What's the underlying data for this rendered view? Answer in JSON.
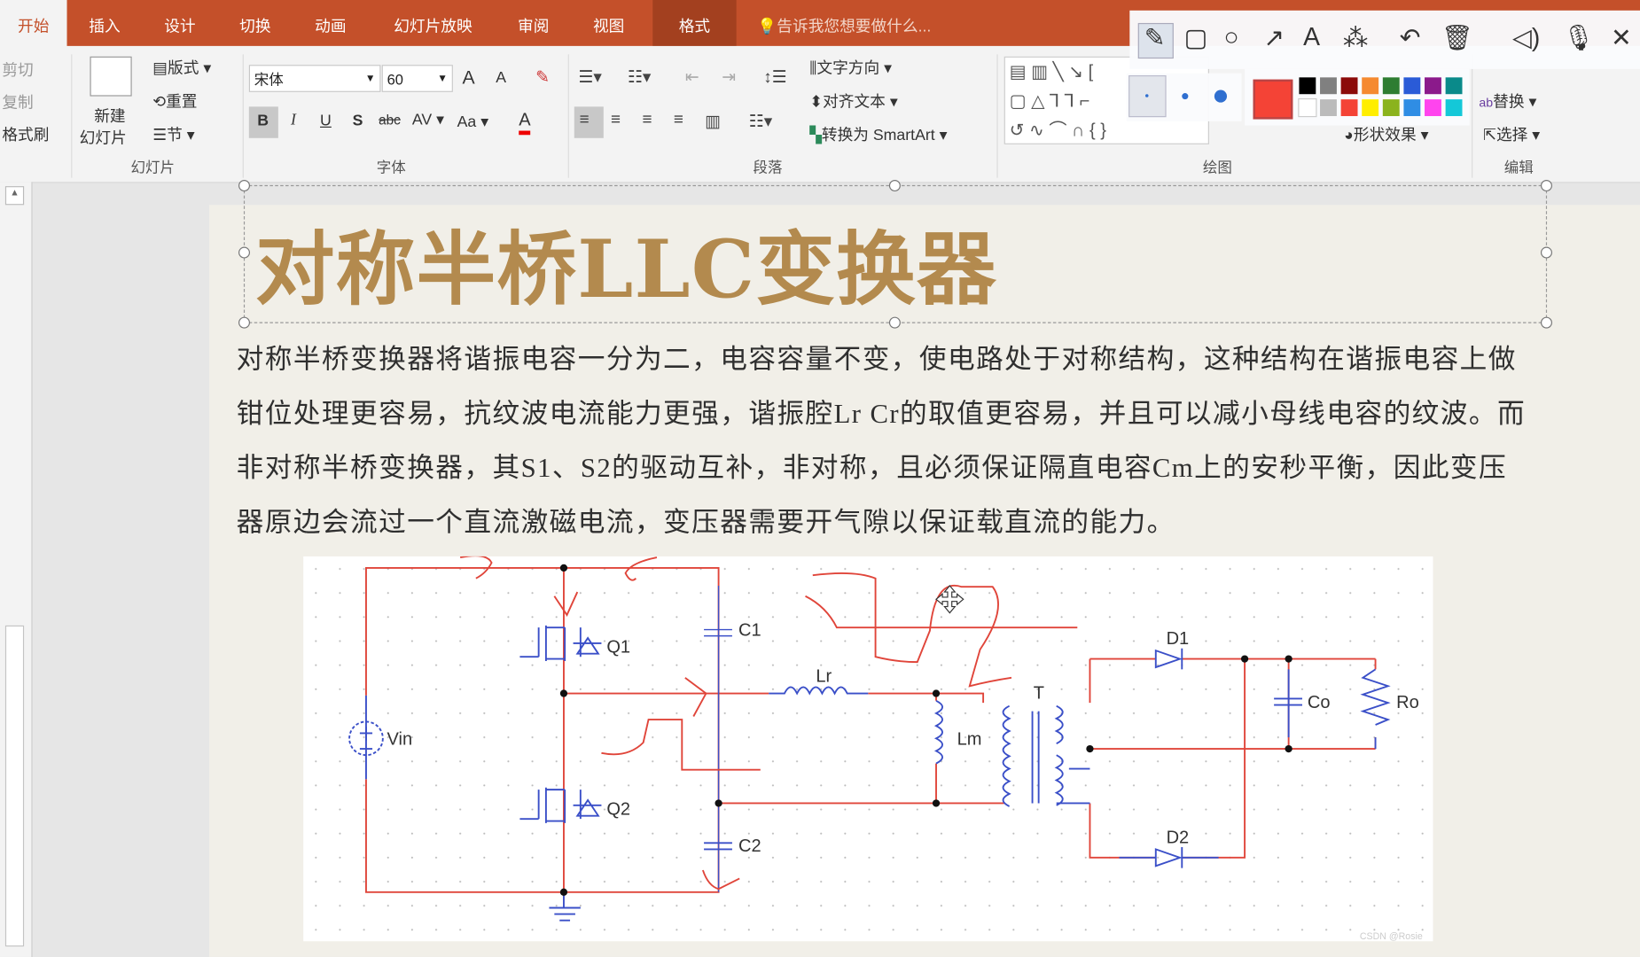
{
  "tabs": [
    "开始",
    "插入",
    "设计",
    "切换",
    "动画",
    "幻灯片放映",
    "审阅",
    "视图",
    "格式"
  ],
  "active_tab": "开始",
  "tell_me": "告诉我您想要做什么...",
  "clipboard": {
    "cut": "剪切",
    "copy": "复制",
    "format_painter": "格式刷"
  },
  "slides": {
    "new_slide_1": "新建",
    "new_slide_2": "幻灯片",
    "layout": "版式",
    "reset": "重置",
    "section": "节",
    "group": "幻灯片"
  },
  "font": {
    "name": "宋体",
    "size": "60",
    "bold": "B",
    "italic": "I",
    "underline": "U",
    "shadow": "S",
    "strike": "abc",
    "spacing": "AV",
    "case": "Aa",
    "color": "A",
    "grow": "A",
    "shrink": "A",
    "group": "字体"
  },
  "paragraph": {
    "text_direction": "文字方向",
    "align_text": "对齐文本",
    "smartart": "转换为 SmartArt",
    "group": "段落"
  },
  "drawing": {
    "shape_effects": "形状效果",
    "group": "绘图"
  },
  "editing": {
    "replace": "替换",
    "select": "选择",
    "group": "编辑"
  },
  "pen_toolbar": {
    "tools": [
      "pencil-icon",
      "rectangle-icon",
      "circle-icon",
      "arrow-icon",
      "text-icon",
      "magic-wand-icon",
      "undo-icon",
      "trash-icon",
      "speaker-icon",
      "microphone-icon",
      "close-icon"
    ],
    "selected_color": "#f44336",
    "colors": [
      "#000000",
      "#808080",
      "#8b0a0a",
      "#f58a30",
      "#2e7d32",
      "#2a5bd7",
      "#8b1a8b",
      "#0a8a8a",
      "#ffffff",
      "#bbbbbb",
      "#f44336",
      "#ffee00",
      "#8bb31d",
      "#2f8de4",
      "#ff44ee",
      "#14c8d8"
    ]
  },
  "slide": {
    "title": "对称半桥LLC变换器",
    "body": "对称半桥变换器将谐振电容一分为二，电容容量不变，使电路处于对称结构，这种结构在谐振电容上做钳位处理更容易，抗纹波电流能力更强，谐振腔Lr Cr的取值更容易，并且可以减小母线电容的纹波。而非对称半桥变换器，其S1、S2的驱动互补，非对称，且必须保证隔直电容Cm上的安秒平衡，因此变压器原边会流过一个直流激磁电流，变压器需要开气隙以保证载直流的能力。",
    "circuit_labels": {
      "vin": "Vin",
      "q1": "Q1",
      "q2": "Q2",
      "c1": "C1",
      "c2": "C2",
      "lr": "Lr",
      "lm": "Lm",
      "t": "T",
      "d1": "D1",
      "d2": "D2",
      "co": "Co",
      "ro": "Ro"
    },
    "watermark": "CSDN @Rosie"
  },
  "colors": {
    "accent": "#c4502a",
    "title": "#b38a4e",
    "wire_red": "#e0453a",
    "wire_blue": "#3a4fc8"
  }
}
